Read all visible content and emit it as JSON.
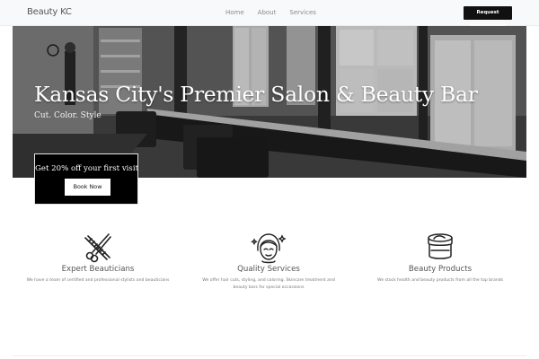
{
  "navbar": {
    "brand": "Beauty KC",
    "links": [
      "Home",
      "About",
      "Services"
    ],
    "cta": "Request Appointment"
  },
  "hero": {
    "title": "Kansas City's Premier Salon & Beauty Bar",
    "subtitle": "Cut. Color. Style"
  },
  "offer": {
    "text": "Get 20% off your first visit",
    "button": "Book Now"
  },
  "features": [
    {
      "icon": "scissors-comb-icon",
      "title": "Expert Beauticians",
      "desc": "We have a team of certified and professional stylists and beauticians"
    },
    {
      "icon": "woman-face-sparkle-icon",
      "title": "Quality Services",
      "desc": "We offer hair cuts, styling, and coloring. Skincare treatment and beauty bars for special occassions"
    },
    {
      "icon": "cream-jar-icon",
      "title": "Beauty Products",
      "desc": "We stock health and beauty products from all the top brands"
    }
  ],
  "colors": {
    "navbar_bg": "#f8f9fa",
    "cta_bg": "#111111",
    "offer_bg": "#000000",
    "text_muted": "#777777"
  }
}
